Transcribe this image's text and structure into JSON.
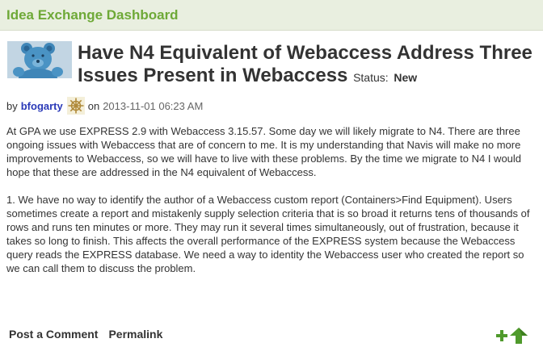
{
  "header": {
    "title": "Idea Exchange Dashboard"
  },
  "post": {
    "title": "Have N4 Equivalent of Webaccess Address Three Issues Present in Webaccess",
    "status_label": "Status:",
    "status_value": "New",
    "byline_prefix": "by",
    "author": "bfogarty",
    "date_prefix": "on",
    "date": "2013-11-01 06:23 AM",
    "paragraphs": [
      "At GPA we use EXPRESS 2.9 with Webaccess 3.15.57. Some day we will likely migrate to N4. There are three ongoing issues with Webaccess that are of concern to me. It is my understanding that Navis will make no more improvements to Webaccess, so we will have to live with these problems. By the time we migrate to N4 I would hope that these are addressed  in the N4 equivalent of Webaccess.",
      "1. We  have no way to identify the author of a Webaccess custom report (Containers>Find Equipment). Users sometimes create a report and mistakenly supply selection criteria that is so broad it returns tens of thousands of rows and runs ten minutes or more. They may run it several times simultaneously, out of frustration, because it takes so long to finish. This affects the overall performance of the EXPRESS system because the Webaccess query reads the EXPRESS database. We need a way to identity the Webaccess user who created the report so we can call them to discuss the problem."
    ]
  },
  "footer": {
    "post_comment": "Post a Comment",
    "permalink": "Permalink"
  },
  "icons": {
    "avatar": "teddy-bear-avatar",
    "rank": "ship-wheel-icon",
    "kudos": "plus-arrow-icon"
  },
  "colors": {
    "header_bg": "#e9efe0",
    "header_text": "#6ea937",
    "author_link": "#2b3ab8",
    "kudos_green": "#4f9a2c"
  }
}
